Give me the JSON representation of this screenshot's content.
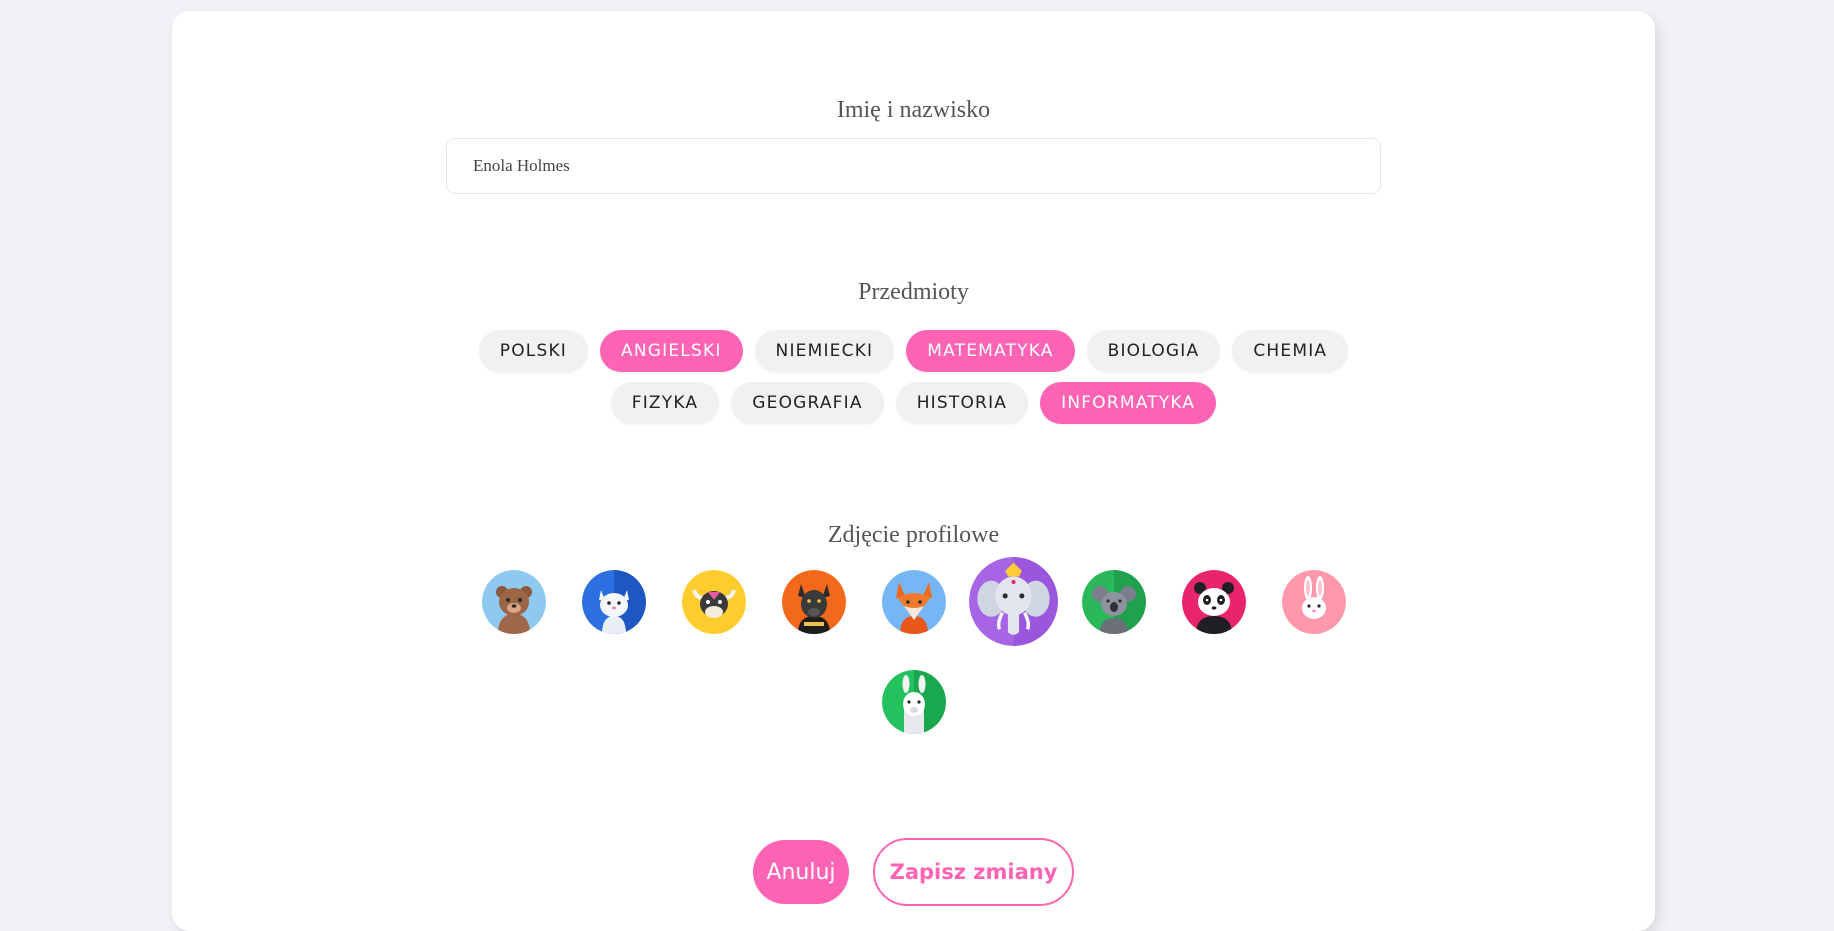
{
  "form": {
    "name_label": "Imię i nazwisko",
    "name_value": "Enola Holmes",
    "subjects_label": "Przedmioty",
    "subjects_row1": [
      {
        "label": "POLSKI",
        "selected": false
      },
      {
        "label": "ANGIELSKI",
        "selected": true
      },
      {
        "label": "NIEMIECKI",
        "selected": false
      },
      {
        "label": "MATEMATYKA",
        "selected": true
      },
      {
        "label": "BIOLOGIA",
        "selected": false
      },
      {
        "label": "CHEMIA",
        "selected": false
      }
    ],
    "subjects_row2": [
      {
        "label": "FIZYKA",
        "selected": false
      },
      {
        "label": "GEOGRAFIA",
        "selected": false
      },
      {
        "label": "HISTORIA",
        "selected": false
      },
      {
        "label": "INFORMATYKA",
        "selected": true
      }
    ],
    "photo_label": "Zdjęcie profilowe",
    "avatars": [
      {
        "name": "bear-avatar-icon",
        "bg": "#8ec9f0",
        "selected": false
      },
      {
        "name": "cat-avatar-icon",
        "bg": "#2b6fe0",
        "selected": false
      },
      {
        "name": "bull-avatar-icon",
        "bg": "#ffcc2e",
        "selected": false
      },
      {
        "name": "dog-avatar-icon",
        "bg": "#f4681b",
        "selected": false
      },
      {
        "name": "fox-avatar-icon",
        "bg": "#76b6f5",
        "selected": false
      },
      {
        "name": "elephant-avatar-icon",
        "bg": "#a765e6",
        "selected": true
      },
      {
        "name": "koala-avatar-icon",
        "bg": "#2bb85b",
        "selected": false
      },
      {
        "name": "panda-avatar-icon",
        "bg": "#e8246b",
        "selected": false
      },
      {
        "name": "rabbit-avatar-icon",
        "bg": "#ff98ab",
        "selected": false
      },
      {
        "name": "llama-avatar-icon",
        "bg": "#24c25e",
        "selected": false
      }
    ],
    "cancel_label": "Anuluj",
    "save_label": "Zapisz zmiany"
  },
  "colors": {
    "accent": "#ff63b4",
    "chip_bg": "#f1f1f4",
    "page_bg": "#f1f2f5"
  }
}
